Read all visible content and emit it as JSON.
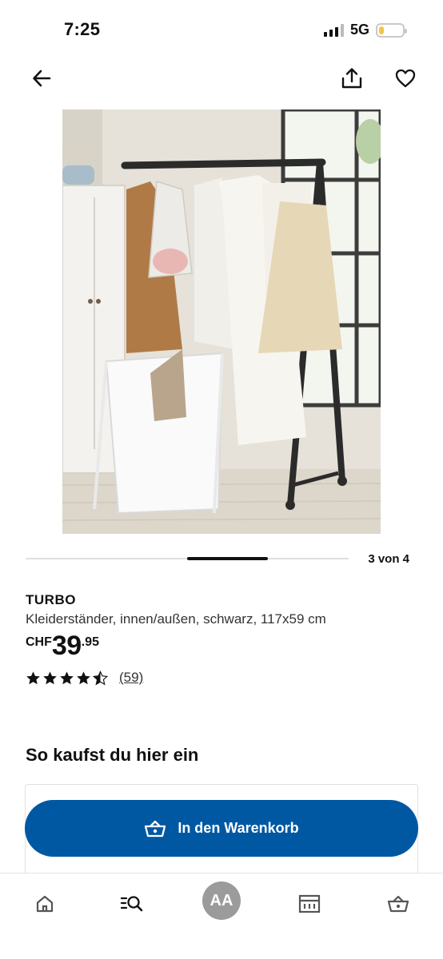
{
  "status_bar": {
    "time": "7:25",
    "network": "5G",
    "battery_level": 0.2,
    "battery_color": "#f4c542"
  },
  "top_nav": {
    "back_icon": "arrow-left-icon",
    "share_icon": "share-upload-icon",
    "favorite_icon": "heart-outline-icon"
  },
  "carousel": {
    "count_text": "3 von 4",
    "current": 3,
    "total": 4
  },
  "product": {
    "name": "TURBO",
    "description": "Kleiderständer, innen/außen, schwarz, 117x59 cm",
    "price_currency": "CHF",
    "price_main": "39",
    "price_cents": ".95",
    "rating": 4.5,
    "rating_max": 5,
    "review_count": "(59)"
  },
  "buy_section": {
    "title": "So kaufst du hier ein",
    "add_to_cart_label": "In den Warenkorb",
    "add_to_cart_icon": "shopping-basket-icon",
    "button_color": "#0058a3"
  },
  "tab_bar": {
    "home_icon": "home-icon",
    "search_icon": "search-list-icon",
    "account_label": "AA",
    "stores_icon": "store-icon",
    "cart_icon": "shopping-basket-icon"
  }
}
